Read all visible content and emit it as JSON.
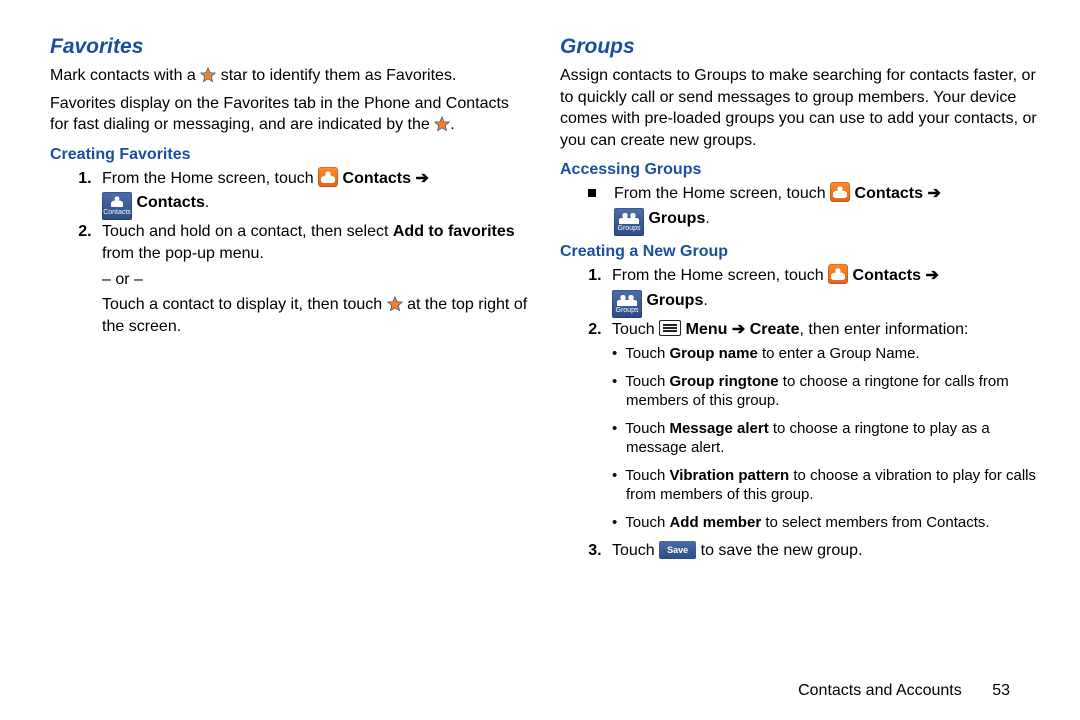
{
  "left": {
    "heading": "Favorites",
    "para1_a": "Mark contacts with a ",
    "para1_b": " star to identify them as Favorites.",
    "para2": "Favorites display on the Favorites tab in the Phone and Contacts for fast dialing or messaging, and are indicated by the ",
    "sub_creating": "Creating Favorites",
    "step1_a": "From the Home screen, touch ",
    "contacts_bold": "Contacts",
    "arrow": "➔",
    "contacts_tab": "Contacts",
    "step2_a": "Touch and hold on a contact, then select ",
    "step2_bold": "Add to favorites",
    "step2_b": " from the pop-up menu.",
    "or": "– or –",
    "alt_a": "Touch a contact to display it, then touch ",
    "alt_b": " at the top right of the screen."
  },
  "right": {
    "heading": "Groups",
    "para1": "Assign contacts to Groups to make searching for contacts faster, or to quickly call or send messages to group members. Your device comes with pre-loaded groups you can use to add your contacts, or you can create new groups.",
    "sub_access": "Accessing Groups",
    "access_a": "From the Home screen, touch ",
    "groups_tab": "Groups",
    "sub_create": "Creating a New Group",
    "c1_a": "From the Home screen, touch ",
    "c2_a": "Touch ",
    "menu_bold": "Menu",
    "create_bold": "Create",
    "c2_b": ", then enter information:",
    "bul1_a": "Touch ",
    "bul1_bold": "Group name",
    "bul1_b": " to enter a Group Name.",
    "bul2_bold": "Group ringtone",
    "bul2_b": " to choose a ringtone for calls from members of this group.",
    "bul3_bold": "Message alert",
    "bul3_b": " to choose a ringtone to play as a message alert.",
    "bul4_bold": "Vibration pattern",
    "bul4_b": " to choose a vibration to play for calls from members of this group.",
    "bul5_bold": "Add member",
    "bul5_b": " to select members from Contacts.",
    "c3_a": "Touch ",
    "save_label": "Save",
    "c3_b": " to save the new group."
  },
  "footer": {
    "section": "Contacts and Accounts",
    "page": "53"
  }
}
